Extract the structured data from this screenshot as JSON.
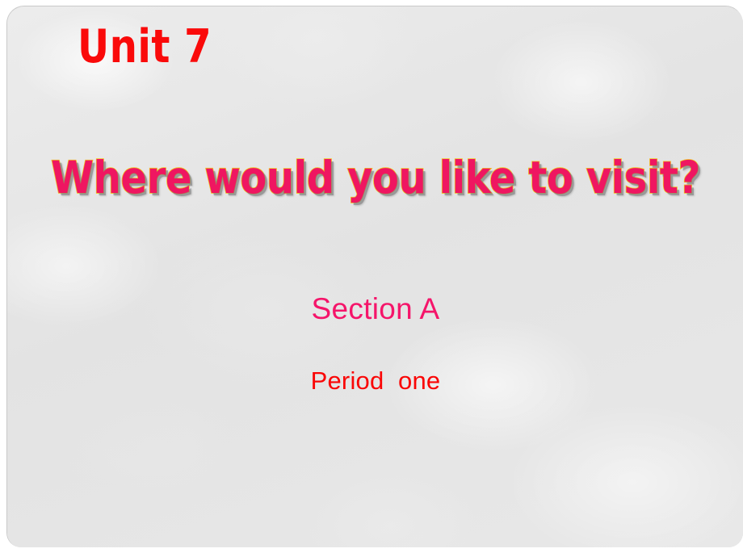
{
  "slide": {
    "unit_heading": "Unit 7",
    "main_title": "Where would you like to visit?",
    "section_label": "Section A",
    "period_label": "Period  one",
    "colors": {
      "background": "#e5e5e5",
      "unit_heading": "#fa0a0a",
      "title_fill": "#ef1661",
      "title_outline": "#f2c21e",
      "title_shadow": "#787878",
      "section_label": "#f5156a",
      "period_label": "#fa0505",
      "frame_border": "#c9c9c9",
      "page_background": "#ffffff"
    }
  }
}
